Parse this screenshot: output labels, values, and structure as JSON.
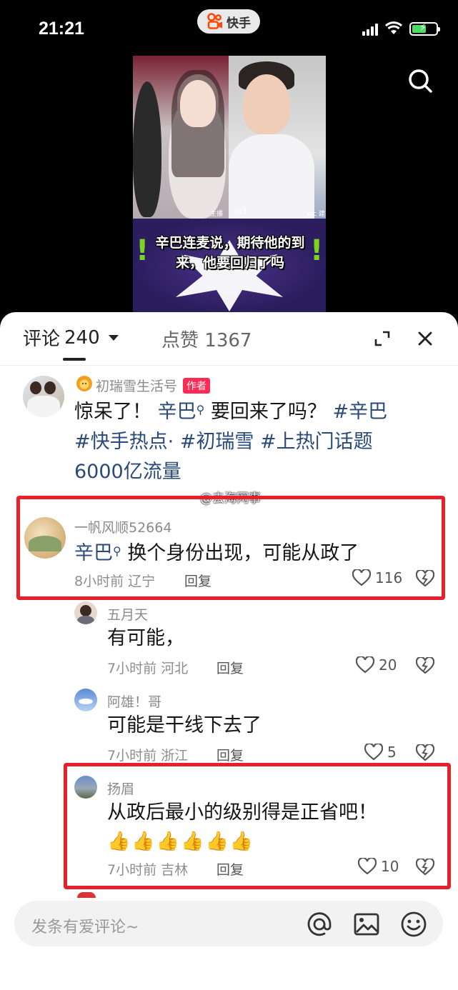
{
  "status_bar": {
    "time": "21:21",
    "app_name": "快手"
  },
  "video": {
    "caption_line1": "辛巴连麦说，期待他的到",
    "caption_line2": "来，他要回归了吗",
    "host_tag": "主播",
    "viewer_count": "115",
    "right_tag": "nic 建"
  },
  "tabs": {
    "comments_label": "评论",
    "comments_count": "240",
    "likes_label": "点赞",
    "likes_count": "1367"
  },
  "watermark": "@去海网事",
  "post": {
    "author": "初瑞雪生活号",
    "author_tag": "作者",
    "line1_a": "惊呆了！",
    "line1_link": "辛巴",
    "line1_b": "要回来了吗？",
    "line1_tag": "#辛巴",
    "line2": "#快手热点· #初瑞雪 #上热门话题",
    "line3": "6000亿流量"
  },
  "comments": [
    {
      "user": "一帆风顺52664",
      "link": "辛巴",
      "text": "换个身份出现，可能从政了",
      "time": "8小时前",
      "location": "辽宁",
      "reply": "回复",
      "likes": "116"
    },
    {
      "user": "五月天",
      "text": "有可能，",
      "time": "7小时前",
      "location": "河北",
      "reply": "回复",
      "likes": "20"
    },
    {
      "user": "阿雄！哥",
      "text": "可能是干线下去了",
      "time": "7小时前",
      "location": "浙江",
      "reply": "回复",
      "likes": "5"
    },
    {
      "user": "扬眉",
      "text": "从政后最小的级别得是正省吧！",
      "emoji_line": "👍👍👍👍👍👍",
      "time": "7小时前",
      "location": "吉林",
      "reply": "回复",
      "likes": "10"
    }
  ],
  "input": {
    "placeholder": "发条有爱评论~"
  },
  "colors": {
    "highlight_box": "#e8202a",
    "link": "#2a4a7a",
    "author_tag": "#fe2c55"
  }
}
